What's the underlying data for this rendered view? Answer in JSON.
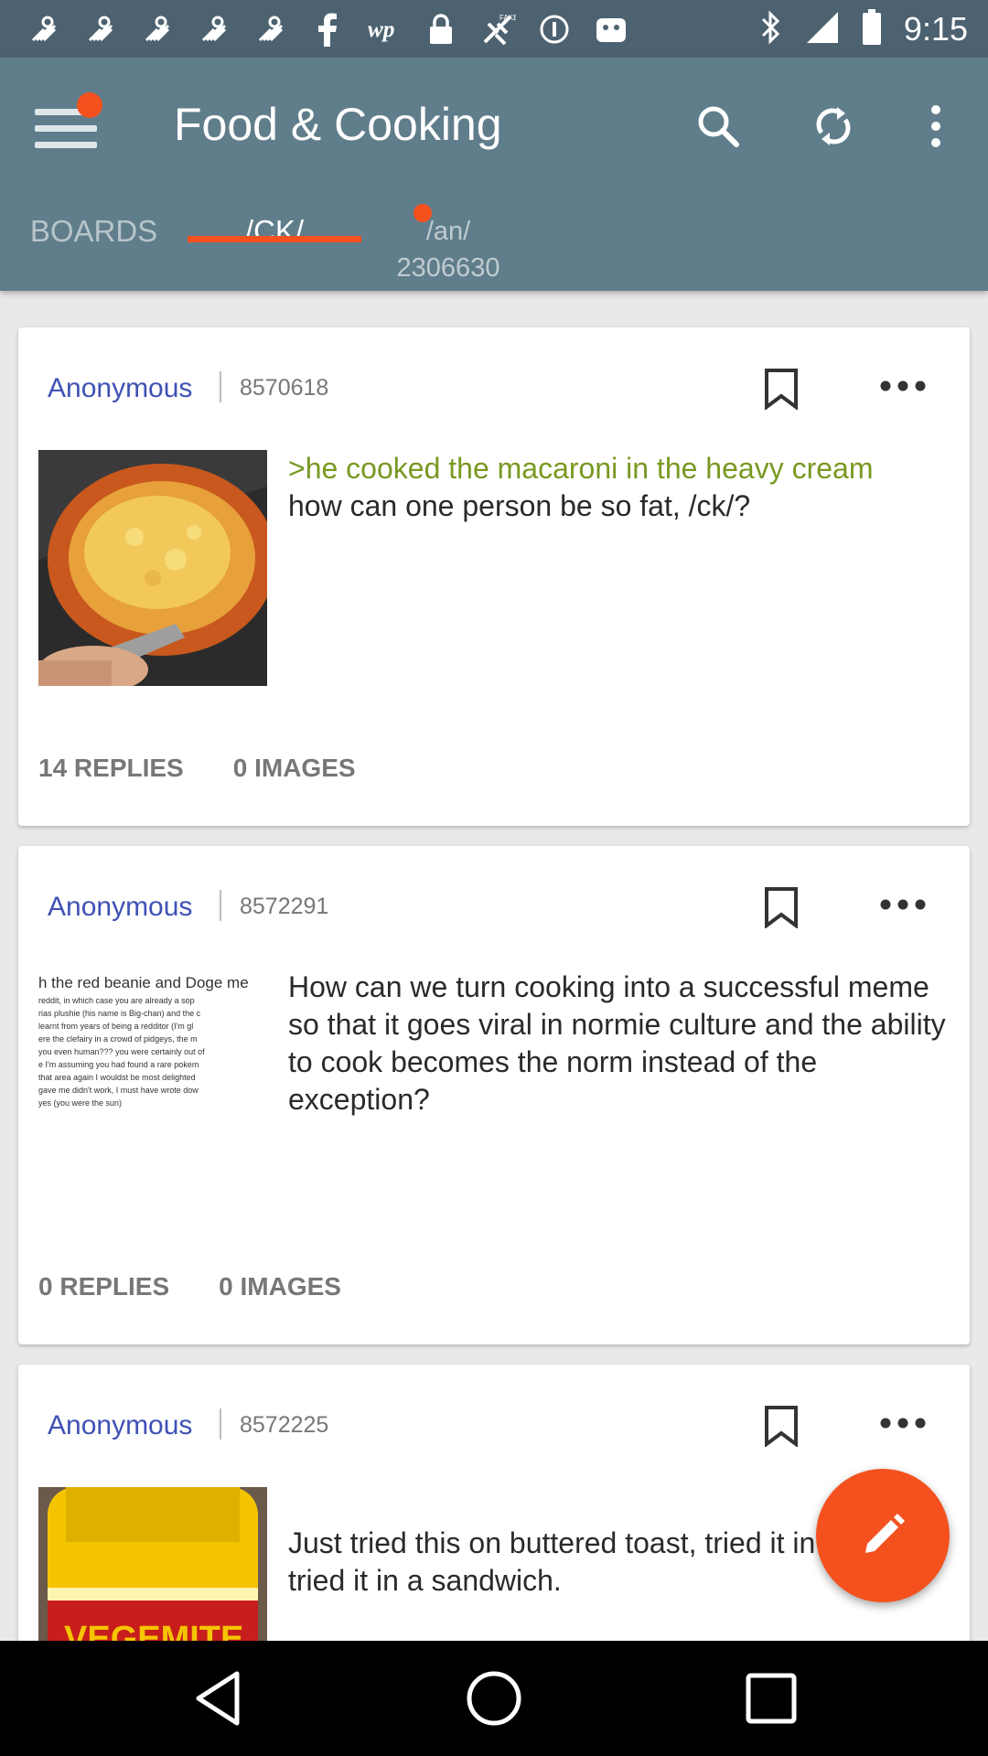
{
  "status_bar": {
    "time": "9:15",
    "icons": [
      "app-icon",
      "app-icon",
      "app-icon",
      "app-icon",
      "app-icon",
      "facebook-icon",
      "washington-post-icon",
      "lock-icon",
      "no-signal-icon",
      "info-circle-icon",
      "android-icon",
      "bluetooth-icon",
      "signal-icon",
      "battery-icon"
    ]
  },
  "app_bar": {
    "title": "Food & Cooking",
    "actions": [
      "search-icon",
      "refresh-icon",
      "more-vert-icon"
    ],
    "accent_color": "#f4511e",
    "bar_color": "#607d8b"
  },
  "tabs": [
    {
      "label": "BOARDS",
      "selected": false
    },
    {
      "label": "/CK/",
      "selected": true
    },
    {
      "label": "/an/",
      "sublabel": "2306630",
      "selected": false
    }
  ],
  "posts": [
    {
      "author": "Anonymous",
      "number": "8570618",
      "greentext": ">he cooked the macaroni in the heavy cream",
      "text": "how can one person be so fat, /ck/?",
      "replies": "14 REPLIES",
      "images": "0 IMAGES",
      "thumb": "macaroni-pan-photo"
    },
    {
      "author": "Anonymous",
      "number": "8572291",
      "greentext": "",
      "text": "How can we turn cooking into a successful meme so that it goes viral in normie culture and the ability to cook becomes the norm instead of the exception?",
      "replies": "0 REPLIES",
      "images": "0 IMAGES",
      "thumb": "text-screenshot",
      "thumb_lines": [
        "h the red beanie and Doge me",
        "",
        "reddit, in which case you are already a sop",
        "rias plushie (his name is Big-chan) and the c",
        "learnt from years of being a redditor (I'm gl",
        "ere the clefairy in a crowd of pidgeys, the m",
        "you even human??? you were certainly out of",
        "e I'm assuming you had found a rare pokem",
        "that area again I wouldst be most delighted",
        "",
        "gave me didn't work, I must have wrote dow",
        "yes (you were the sun)"
      ]
    },
    {
      "author": "Anonymous",
      "number": "8572225",
      "greentext": "",
      "text": "Just tried this on buttered toast, tried it in eggs and tried it in a sandwich.\n\nIt tastes awful. Even spread thinly, this is such",
      "replies": "",
      "images": "",
      "thumb": "vegemite-jar-photo",
      "thumb_label": "VEGEMITE"
    }
  ],
  "fab": {
    "icon": "pencil-icon"
  },
  "nav_bar": {
    "buttons": [
      "back-icon",
      "home-icon",
      "recents-icon"
    ]
  }
}
